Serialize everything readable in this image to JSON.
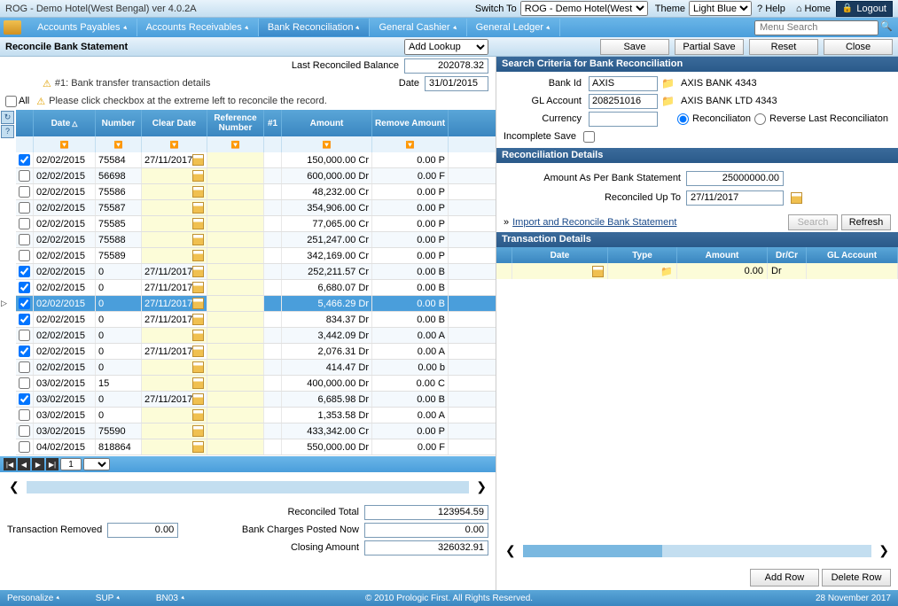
{
  "titleBar": {
    "title": "ROG - Demo Hotel(West Bengal) ver 4.0.2A",
    "switchToLabel": "Switch To",
    "switchToValue": "ROG - Demo Hotel(West",
    "themeLabel": "Theme",
    "themeValue": "Light Blue",
    "help": "? Help",
    "home": "⌂ Home",
    "logout": "Logout"
  },
  "menu": {
    "items": [
      "Accounts Payables",
      "Accounts Receivables",
      "Bank Reconciliation",
      "General Cashier",
      "General Ledger"
    ],
    "activeIndex": 2,
    "searchPlaceholder": "Menu Search"
  },
  "pageHeader": {
    "title": "Reconcile Bank Statement",
    "lookup": "Add Lookup",
    "buttons": [
      "Save",
      "Partial Save",
      "Reset",
      "Close"
    ]
  },
  "leftPanel": {
    "lastReconciledLabel": "Last Reconciled Balance",
    "lastReconciledValue": "202078.32",
    "note1": "#1: Bank transfer transaction details",
    "dateLabel": "Date",
    "dateValue": "31/01/2015",
    "allLabel": "All",
    "note2": "Please click checkbox at the extreme left to reconcile the record.",
    "gridHeaders": [
      "",
      "Date",
      "Number",
      "Clear Date",
      "Reference Number",
      "#1",
      "Amount",
      "Remove Amount"
    ],
    "rows": [
      {
        "chk": true,
        "date": "02/02/2015",
        "num": "75584",
        "clr": "27/11/2017",
        "amt": "150,000.00 Cr",
        "rem": "0.00 P"
      },
      {
        "chk": false,
        "date": "02/02/2015",
        "num": "56698",
        "clr": "",
        "amt": "600,000.00 Dr",
        "rem": "0.00 F"
      },
      {
        "chk": false,
        "date": "02/02/2015",
        "num": "75586",
        "clr": "",
        "amt": "48,232.00 Cr",
        "rem": "0.00 P"
      },
      {
        "chk": false,
        "date": "02/02/2015",
        "num": "75587",
        "clr": "",
        "amt": "354,906.00 Cr",
        "rem": "0.00 P"
      },
      {
        "chk": false,
        "date": "02/02/2015",
        "num": "75585",
        "clr": "",
        "amt": "77,065.00 Cr",
        "rem": "0.00 P"
      },
      {
        "chk": false,
        "date": "02/02/2015",
        "num": "75588",
        "clr": "",
        "amt": "251,247.00 Cr",
        "rem": "0.00 P"
      },
      {
        "chk": false,
        "date": "02/02/2015",
        "num": "75589",
        "clr": "",
        "amt": "342,169.00 Cr",
        "rem": "0.00 P"
      },
      {
        "chk": true,
        "date": "02/02/2015",
        "num": "0",
        "clr": "27/11/2017",
        "amt": "252,211.57 Cr",
        "rem": "0.00 B"
      },
      {
        "chk": true,
        "date": "02/02/2015",
        "num": "0",
        "clr": "27/11/2017",
        "amt": "6,680.07 Dr",
        "rem": "0.00 B"
      },
      {
        "chk": true,
        "date": "02/02/2015",
        "num": "0",
        "clr": "27/11/2017",
        "amt": "5,466.29 Dr",
        "rem": "0.00 B",
        "selected": true
      },
      {
        "chk": true,
        "date": "02/02/2015",
        "num": "0",
        "clr": "27/11/2017",
        "amt": "834.37 Dr",
        "rem": "0.00 B"
      },
      {
        "chk": false,
        "date": "02/02/2015",
        "num": "0",
        "clr": "",
        "amt": "3,442.09 Dr",
        "rem": "0.00 A"
      },
      {
        "chk": true,
        "date": "02/02/2015",
        "num": "0",
        "clr": "27/11/2017",
        "amt": "2,076.31 Dr",
        "rem": "0.00 A"
      },
      {
        "chk": false,
        "date": "02/02/2015",
        "num": "0",
        "clr": "",
        "amt": "414.47 Dr",
        "rem": "0.00 b"
      },
      {
        "chk": false,
        "date": "03/02/2015",
        "num": "15",
        "clr": "",
        "amt": "400,000.00 Dr",
        "rem": "0.00 C"
      },
      {
        "chk": true,
        "date": "03/02/2015",
        "num": "0",
        "clr": "27/11/2017",
        "amt": "6,685.98 Dr",
        "rem": "0.00 B"
      },
      {
        "chk": false,
        "date": "03/02/2015",
        "num": "0",
        "clr": "",
        "amt": "1,353.58 Dr",
        "rem": "0.00 A"
      },
      {
        "chk": false,
        "date": "03/02/2015",
        "num": "75590",
        "clr": "",
        "amt": "433,342.00 Cr",
        "rem": "0.00 P"
      },
      {
        "chk": false,
        "date": "04/02/2015",
        "num": "818864",
        "clr": "",
        "amt": "550,000.00 Dr",
        "rem": "0.00 F"
      }
    ],
    "pagerValue": "1",
    "reconciledTotalLabel": "Reconciled Total",
    "reconciledTotalValue": "123954.59",
    "transactionRemovedLabel": "Transaction Removed",
    "transactionRemovedValue": "0.00",
    "bankChargesLabel": "Bank Charges Posted Now",
    "bankChargesValue": "0.00",
    "closingAmountLabel": "Closing Amount",
    "closingAmountValue": "326032.91"
  },
  "rightPanel": {
    "searchCriteriaTitle": "Search Criteria for Bank Reconciliation",
    "bankIdLabel": "Bank Id",
    "bankIdValue": "AXIS",
    "bankIdDesc": "AXIS BANK 4343",
    "glAccountLabel": "GL Account",
    "glAccountValue": "208251016",
    "glAccountDesc": "AXIS BANK LTD 4343",
    "currencyLabel": "Currency",
    "currencyValue": "",
    "reconRadio": "Reconciliaton",
    "reverseRadio": "Reverse Last Reconciliaton",
    "incompleteSaveLabel": "Incomplete Save",
    "reconDetailsTitle": "Reconciliation Details",
    "amountAsPerLabel": "Amount As Per Bank Statement",
    "amountAsPerValue": "25000000.00",
    "reconciledUpToLabel": "Reconciled Up To",
    "reconciledUpToValue": "27/11/2017",
    "importLink": "Import and Reconcile Bank Statement",
    "searchBtn": "Search",
    "refreshBtn": "Refresh",
    "transDetailsTitle": "Transaction Details",
    "tdHeaders": [
      "",
      "Date",
      "Type",
      "Amount",
      "Dr/Cr",
      "GL Account"
    ],
    "tdRow": {
      "amt": "0.00",
      "drcr": "Dr"
    },
    "addRowBtn": "Add Row",
    "deleteRowBtn": "Delete Row"
  },
  "footer": {
    "personalize": "Personalize",
    "user": "SUP",
    "code": "BN03",
    "copyright": "© 2010 Prologic First. All Rights Reserved.",
    "date": "28 November 2017"
  }
}
